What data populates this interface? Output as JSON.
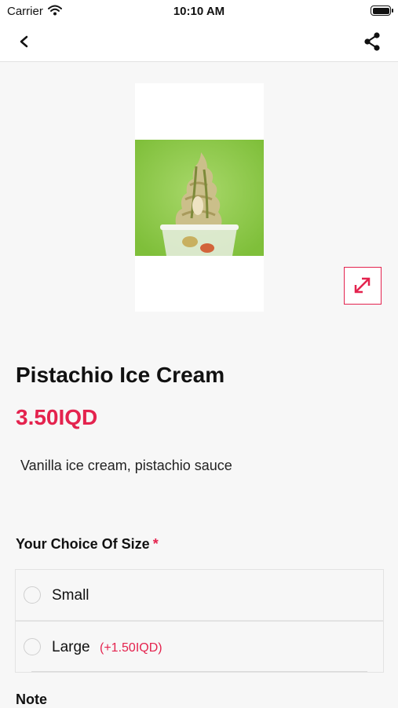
{
  "status_bar": {
    "carrier": "Carrier",
    "time": "10:10 AM"
  },
  "nav": {
    "back_icon": "chevron-left-icon",
    "share_icon": "share-icon"
  },
  "product": {
    "name": "Pistachio Ice Cream",
    "price": "3.50IQD",
    "description": "Vanilla ice cream, pistachio sauce",
    "image_background": "#8cc63f"
  },
  "size_section": {
    "title": "Your Choice Of Size",
    "required_mark": "*",
    "options": [
      {
        "label": "Small",
        "extra": ""
      },
      {
        "label": "Large",
        "extra": "(+1.50IQD)"
      }
    ]
  },
  "note_section": {
    "title": "Note"
  },
  "colors": {
    "accent": "#e4234e",
    "background": "#f7f7f7"
  }
}
